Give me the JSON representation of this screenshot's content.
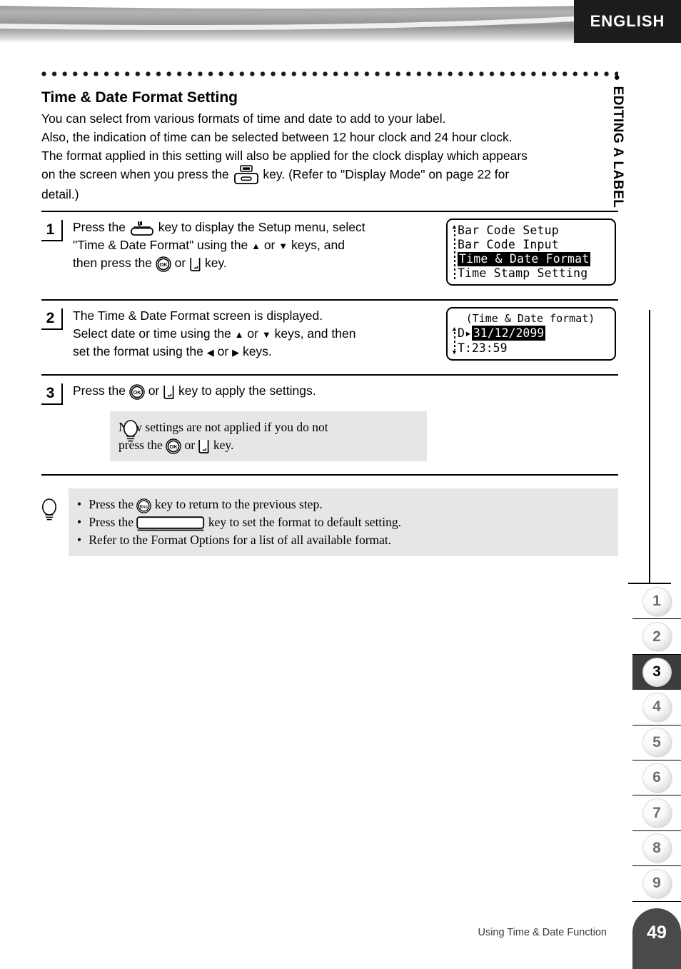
{
  "header": {
    "language_tab": "ENGLISH"
  },
  "side": {
    "chapter_label": "EDITING A LABEL",
    "bullet": "●"
  },
  "section": {
    "title": "Time & Date Format Setting",
    "intro_line_1": "You can select from various formats of time and date to add to your label.",
    "intro_line_2": "Also, the indication of time can be selected between 12 hour clock and 24 hour clock.",
    "intro_line_3a": "The format applied in this setting will also be applied for the clock display which appears",
    "intro_line_3b": "on the screen when you press the",
    "intro_line_3c": "key. (Refer to \"Display Mode\" on page 22 for",
    "intro_line_4": "detail.)"
  },
  "steps": [
    {
      "number": "1",
      "t1": "Press the",
      "t2": "key to display the Setup menu, select",
      "t3": "\"Time & Date Format\" using the",
      "t4": "or",
      "t5": "keys, and",
      "t6": "then press the",
      "t7": "or",
      "t8": "key."
    },
    {
      "number": "2",
      "t1": "The Time & Date Format screen is displayed.",
      "t2": "Select date or time using the",
      "t3": "or",
      "t4": "keys, and then",
      "t5": "set the format using the",
      "t6": "or",
      "t7": "keys."
    },
    {
      "number": "3",
      "t1": "Press the",
      "t2": "or",
      "t3": "key to apply the settings."
    }
  ],
  "lcd_menu": {
    "scroll_arrow": "▲",
    "items": [
      {
        "label": "Bar Code Setup",
        "selected": false
      },
      {
        "label": "Bar Code Input",
        "selected": false
      },
      {
        "label": "Time & Date Format",
        "selected": true
      },
      {
        "label": "Time Stamp Setting",
        "selected": false
      }
    ]
  },
  "lcd_format": {
    "title": "(Time & Date format)",
    "scroll_up": "▲",
    "scroll_down": "▼",
    "date_key": "D",
    "date_marker": "▸",
    "date_value": "31/12/2099",
    "date_selected": true,
    "time_key": "T",
    "time_separator": ":",
    "time_value": "23:59"
  },
  "note_step3": {
    "line_1": "New settings are not applied if you do not",
    "line_2a": "press the",
    "line_2b": "or",
    "line_2c": "key."
  },
  "tips": {
    "bullet": "•",
    "item_1a": "Press the",
    "item_1b": "key to return to the previous step.",
    "item_2a": "Press the",
    "item_2b": "key to set the format to default setting.",
    "item_3": "Refer to the Format Options for a list of all available format."
  },
  "key_labels": {
    "ok": "OK",
    "esc": "Esc"
  },
  "chapter_tabs": {
    "items": [
      "1",
      "2",
      "3",
      "4",
      "5",
      "6",
      "7",
      "8",
      "9"
    ],
    "active": "3"
  },
  "footer": {
    "section_name": "Using Time & Date Function",
    "page_number": "49"
  },
  "colors": {
    "note_background": "#e6e6e6",
    "active_tab": "#3d3d3d",
    "page_tab": "#4a4a4a",
    "header_tab": "#1c1c1c"
  }
}
